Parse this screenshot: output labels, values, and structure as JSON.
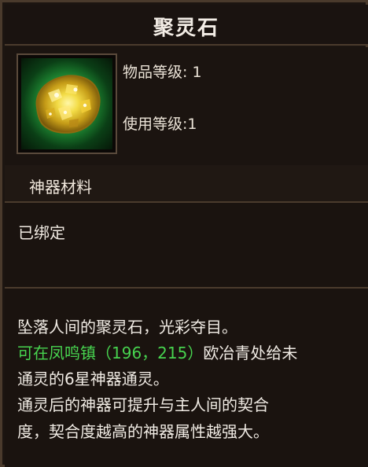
{
  "window": {
    "title": "聚灵石"
  },
  "item": {
    "icon": "gold-ore-icon",
    "level_label": "物品等级: 1",
    "use_label": "使用等级:1",
    "category": "神器材料",
    "bind_status": "已绑定"
  },
  "description": {
    "line1": "坠落人间的聚灵石，光彩夺目。",
    "line2_prefix": "可在",
    "line2_location": "凤鸣镇（196，215）",
    "line2_suffix": "欧冶青处给未",
    "line3": "通灵的6星神器通灵。",
    "line4": "通灵后的神器可提升与主人间的契合",
    "line5": "度，契合度越高的神器属性越强大。"
  },
  "colors": {
    "highlight_green": "#47d34f",
    "text_primary": "#f0ebe4",
    "panel_background": "#1a130f",
    "border": "#4a3a2c"
  }
}
